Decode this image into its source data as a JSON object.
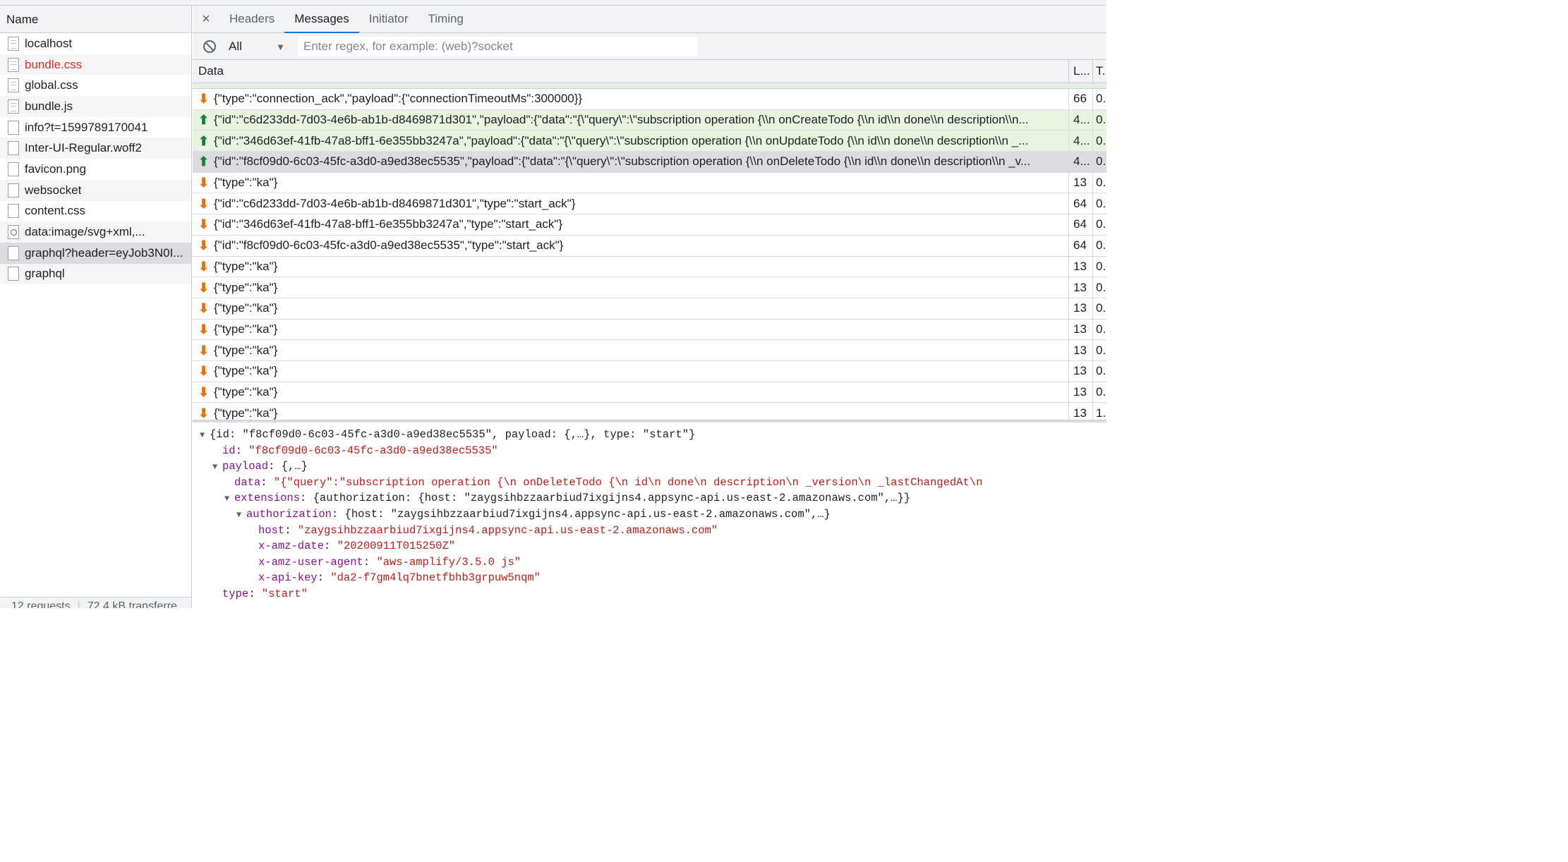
{
  "left": {
    "header": "Name",
    "requests": [
      {
        "name": "localhost",
        "icon": "document-icon",
        "error": false
      },
      {
        "name": "bundle.css",
        "icon": "document-icon",
        "error": true
      },
      {
        "name": "global.css",
        "icon": "document-icon",
        "error": false
      },
      {
        "name": "bundle.js",
        "icon": "document-icon",
        "error": false
      },
      {
        "name": "info?t=1599789170041",
        "icon": "blank-file-icon",
        "error": false
      },
      {
        "name": "Inter-UI-Regular.woff2",
        "icon": "blank-file-icon",
        "error": false
      },
      {
        "name": "favicon.png",
        "icon": "blank-file-icon",
        "error": false
      },
      {
        "name": "websocket",
        "icon": "blank-file-icon",
        "error": false
      },
      {
        "name": "content.css",
        "icon": "blank-file-icon",
        "error": false
      },
      {
        "name": "data:image/svg+xml,...",
        "icon": "image-icon",
        "error": false
      },
      {
        "name": "graphql?header=eyJob3N0I...",
        "icon": "blank-file-icon",
        "error": false,
        "selected": true
      },
      {
        "name": "graphql",
        "icon": "blank-file-icon",
        "error": false
      }
    ],
    "footer": {
      "requests": "12 requests",
      "transferred": "72.4 kB transferre"
    }
  },
  "tabs": {
    "close": "×",
    "items": [
      "Headers",
      "Messages",
      "Initiator",
      "Timing"
    ],
    "active": "Messages"
  },
  "filter": {
    "select_value": "All",
    "placeholder": "Enter regex, for example: (web)?socket"
  },
  "grid": {
    "col_data": "Data",
    "col_length": "L...",
    "col_time": "T.",
    "messages": [
      {
        "dir": "down",
        "text": "{\"type\":\"connection_ack\",\"payload\":{\"connectionTimeoutMs\":300000}}",
        "length": "66",
        "time": "0."
      },
      {
        "dir": "up",
        "text": "{\"id\":\"c6d233dd-7d03-4e6b-ab1b-d8469871d301\",\"payload\":{\"data\":\"{\\\"query\\\":\\\"subscription operation {\\\\n onCreateTodo {\\\\n id\\\\n done\\\\n description\\\\n...",
        "length": "4...",
        "time": "0."
      },
      {
        "dir": "up",
        "text": "{\"id\":\"346d63ef-41fb-47a8-bff1-6e355bb3247a\",\"payload\":{\"data\":\"{\\\"query\\\":\\\"subscription operation {\\\\n onUpdateTodo {\\\\n id\\\\n done\\\\n description\\\\n _...",
        "length": "4...",
        "time": "0."
      },
      {
        "dir": "up",
        "text": "{\"id\":\"f8cf09d0-6c03-45fc-a3d0-a9ed38ec5535\",\"payload\":{\"data\":\"{\\\"query\\\":\\\"subscription operation {\\\\n onDeleteTodo {\\\\n id\\\\n done\\\\n description\\\\n _v...",
        "length": "4...",
        "time": "0.",
        "selected": true
      },
      {
        "dir": "down",
        "text": "{\"type\":\"ka\"}",
        "length": "13",
        "time": "0."
      },
      {
        "dir": "down",
        "text": "{\"id\":\"c6d233dd-7d03-4e6b-ab1b-d8469871d301\",\"type\":\"start_ack\"}",
        "length": "64",
        "time": "0."
      },
      {
        "dir": "down",
        "text": "{\"id\":\"346d63ef-41fb-47a8-bff1-6e355bb3247a\",\"type\":\"start_ack\"}",
        "length": "64",
        "time": "0."
      },
      {
        "dir": "down",
        "text": "{\"id\":\"f8cf09d0-6c03-45fc-a3d0-a9ed38ec5535\",\"type\":\"start_ack\"}",
        "length": "64",
        "time": "0."
      },
      {
        "dir": "down",
        "text": "{\"type\":\"ka\"}",
        "length": "13",
        "time": "0."
      },
      {
        "dir": "down",
        "text": "{\"type\":\"ka\"}",
        "length": "13",
        "time": "0."
      },
      {
        "dir": "down",
        "text": "{\"type\":\"ka\"}",
        "length": "13",
        "time": "0."
      },
      {
        "dir": "down",
        "text": "{\"type\":\"ka\"}",
        "length": "13",
        "time": "0."
      },
      {
        "dir": "down",
        "text": "{\"type\":\"ka\"}",
        "length": "13",
        "time": "0."
      },
      {
        "dir": "down",
        "text": "{\"type\":\"ka\"}",
        "length": "13",
        "time": "0."
      },
      {
        "dir": "down",
        "text": "{\"type\":\"ka\"}",
        "length": "13",
        "time": "0."
      },
      {
        "dir": "down",
        "text": "{\"type\":\"ka\"}",
        "length": "13",
        "time": "1."
      }
    ]
  },
  "detail": {
    "root_summary": "{id: \"f8cf09d0-6c03-45fc-a3d0-a9ed38ec5535\", payload: {,…}, type: \"start\"}",
    "id_key": "id",
    "id_val": "\"f8cf09d0-6c03-45fc-a3d0-a9ed38ec5535\"",
    "payload_key": "payload",
    "payload_summary": "{,…}",
    "data_key": "data",
    "data_val": "\"{\"query\":\"subscription operation {\\n  onDeleteTodo {\\n    id\\n    done\\n    description\\n    _version\\n    _lastChangedAt\\n",
    "extensions_key": "extensions",
    "extensions_summary": "{authorization: {host: \"zaygsihbzzaarbiud7ixgijns4.appsync-api.us-east-2.amazonaws.com\",…}}",
    "authorization_key": "authorization",
    "authorization_summary": "{host: \"zaygsihbzzaarbiud7ixgijns4.appsync-api.us-east-2.amazonaws.com\",…}",
    "host_key": "host",
    "host_val": "\"zaygsihbzzaarbiud7ixgijns4.appsync-api.us-east-2.amazonaws.com\"",
    "date_key": "x-amz-date",
    "date_val": "\"20200911T015250Z\"",
    "ua_key": "x-amz-user-agent",
    "ua_val": "\"aws-amplify/3.5.0 js\"",
    "apikey_key": "x-api-key",
    "apikey_val": "\"da2-f7gm4lq7bnetfbhb3grpuw5nqm\"",
    "type_key": "type",
    "type_val": "\"start\""
  }
}
